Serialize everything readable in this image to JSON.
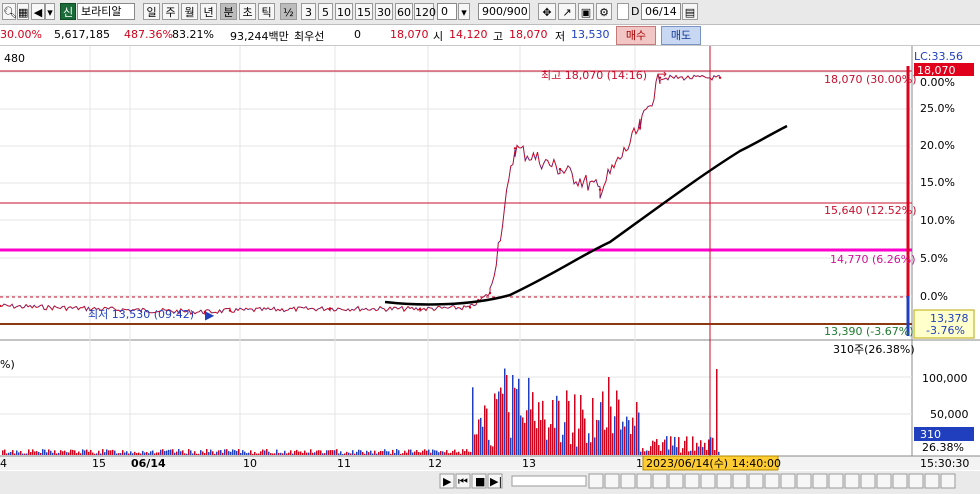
{
  "toolbar": {
    "stock_badge": "신",
    "stock_name": "보라티알",
    "period_buttons": [
      "일",
      "주",
      "월",
      "년",
      "분",
      "초",
      "틱",
      "½",
      "3",
      "5",
      "10",
      "15",
      "30",
      "60",
      "120"
    ],
    "interval_value": "0",
    "count_value": "900/900",
    "checkbox_label": "D",
    "date_value": "06/14"
  },
  "info": {
    "change_pct": "30.00%",
    "volume": "5,617,185",
    "vol_ratio": "487.36%",
    "strength": "83.21%",
    "amount": "93,244백만",
    "priority_label": "최우선",
    "priority_value": "0",
    "current_price": "18,070",
    "open_label": "시",
    "open_value": "14,120",
    "high_label": "고",
    "high_value": "18,070",
    "low_label": "저",
    "low_value": "13,530",
    "buy_label": "매수",
    "sell_label": "매도"
  },
  "chart": {
    "top_left_label": "480",
    "lc_label": "LC:33.56",
    "price_box_top": "18,070",
    "high_annot": "최고 18,070 (14:16)",
    "low_annot": "최저 13,530 (09:42)",
    "line_labels": {
      "upper_limit": "18,070 (30.00%)",
      "mid": "15,640 (12.52%)",
      "magenta": "14,770 (6.26%)",
      "lower": "13,390 (-3.67%)"
    },
    "y_axis": [
      "0.00%",
      "25.0%",
      "20.0%",
      "15.0%",
      "10.0%",
      "5.0%",
      "0.0%"
    ],
    "current_box_price": "13,378",
    "current_box_pct": "-3.76%",
    "volume_top_label": "310주(26.38%)",
    "volume_left_label": "%)",
    "volume_axis": [
      "100,000",
      "50,000"
    ],
    "volume_box": "310",
    "volume_box_pct": "26.38%",
    "x_axis": [
      "4",
      "15",
      "06/14",
      "10",
      "11",
      "12",
      "13",
      "1"
    ],
    "crosshair_time": "2023/06/14(수) 14:40:00",
    "clock": "15:30:30"
  },
  "chart_data": {
    "type": "line",
    "title": "보라티알",
    "x": [
      "09:00",
      "09:42",
      "10:00",
      "11:00",
      "12:00",
      "12:30",
      "12:45",
      "13:00",
      "13:15",
      "13:30",
      "14:00",
      "14:16",
      "14:40"
    ],
    "series": [
      {
        "name": "price",
        "values": [
          13650,
          13530,
          13560,
          13600,
          13590,
          13620,
          13900,
          16700,
          16300,
          15900,
          17100,
          18070,
          18070
        ]
      }
    ],
    "ylim": [
      13300,
      18200
    ]
  }
}
